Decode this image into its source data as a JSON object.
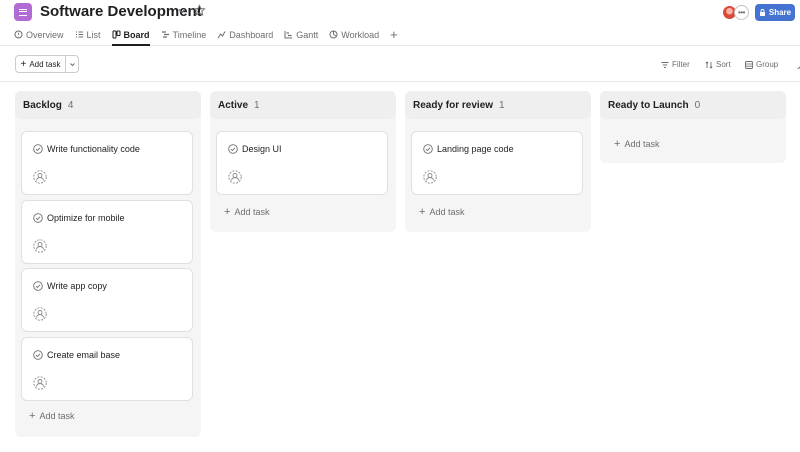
{
  "project": {
    "title": "Software Development",
    "icon": "list-bars-icon",
    "accent_color": "#b36bd4"
  },
  "tabs": [
    {
      "label": "Overview",
      "icon": "overview-icon",
      "active": false
    },
    {
      "label": "List",
      "icon": "list-icon",
      "active": false
    },
    {
      "label": "Board",
      "icon": "board-icon",
      "active": true
    },
    {
      "label": "Timeline",
      "icon": "timeline-icon",
      "active": false
    },
    {
      "label": "Dashboard",
      "icon": "dashboard-icon",
      "active": false
    },
    {
      "label": "Gantt",
      "icon": "gantt-icon",
      "active": false
    },
    {
      "label": "Workload",
      "icon": "workload-icon",
      "active": false
    }
  ],
  "tab_add_label": "+",
  "header_right": {
    "more_label": "•••",
    "share_label": "Share",
    "share_color": "#4573d2"
  },
  "toolbar": {
    "add_task_label": "Add task",
    "filter_label": "Filter",
    "sort_label": "Sort",
    "group_label": "Group"
  },
  "columns": [
    {
      "name": "Backlog",
      "count": "4",
      "tasks": [
        "Write functionality code",
        "Optimize for mobile",
        "Write app copy",
        "Create email base"
      ],
      "add_label": "Add task"
    },
    {
      "name": "Active",
      "count": "1",
      "tasks": [
        "Design UI"
      ],
      "add_label": "Add task"
    },
    {
      "name": "Ready for review",
      "count": "1",
      "tasks": [
        "Landing page code"
      ],
      "add_label": "Add task"
    },
    {
      "name": "Ready to Launch",
      "count": "0",
      "tasks": [],
      "add_label": "Add task"
    }
  ]
}
